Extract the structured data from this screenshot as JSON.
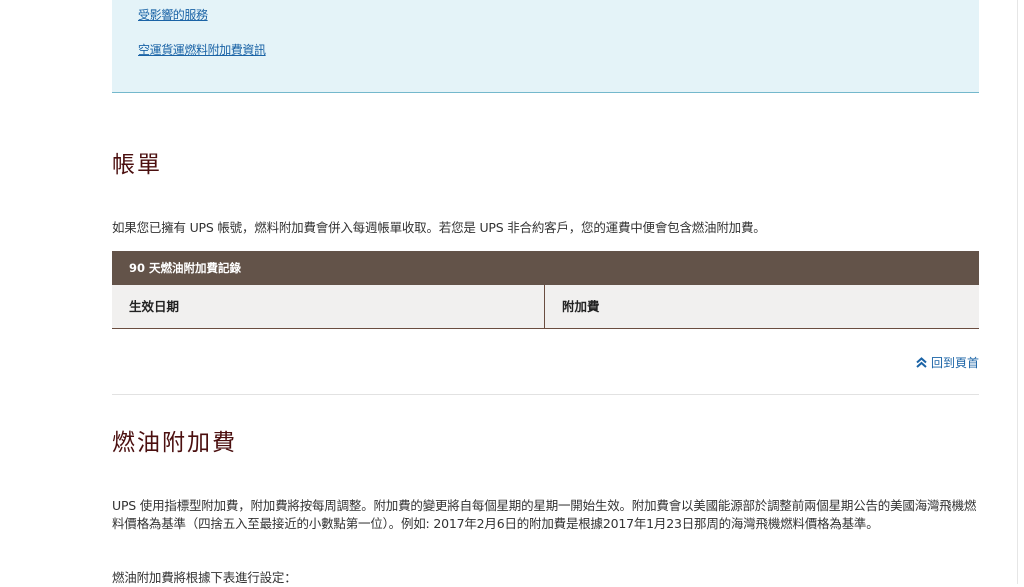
{
  "info_links": [
    "受影響的服務",
    "空運貨運燃料附加費資訊"
  ],
  "billing": {
    "heading": "帳單",
    "text": "如果您已擁有 UPS 帳號，燃料附加費會併入每週帳單收取。若您是 UPS 非合約客戶，您的運費中便會包含燃油附加費。",
    "table": {
      "title": "90 天燃油附加費記錄",
      "columns": [
        "生效日期",
        "附加費"
      ]
    },
    "back_to_top": "回到頁首"
  },
  "fuel": {
    "heading": "燃油附加費",
    "text": "UPS 使用指標型附加費，附加費將按每周調整。附加費的變更將自每個星期的星期一開始生效。附加費會以美國能源部於調整前兩個星期公告的美國海灣飛機燃料價格為基準（四捨五入至最接近的小數點第一位）。例如: 2017年2月6日的附加費是根據2017年1月23日那周的海灣飛機燃料價格為基準。",
    "text2": "燃油附加費將根據下表進行設定："
  },
  "colors": {
    "link": "#1a63a6",
    "heading": "#4b0f0f",
    "table_header_bg": "#635349",
    "info_bg": "#e4f3f8"
  }
}
